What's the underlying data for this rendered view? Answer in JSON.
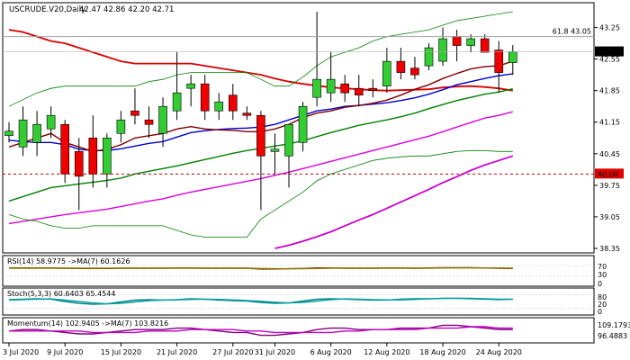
{
  "header": {
    "symbol": "USCRUDE.V20,Daily",
    "ohlc": "42.47 42.86 42.20 42.71"
  },
  "chart_data": [
    {
      "type": "candlestick",
      "title": "USCRUDE.V20,Daily",
      "ylim": [
        38.25,
        43.8
      ],
      "y_ticks": [
        "43.25",
        "42.55",
        "41.85",
        "41.15",
        "40.45",
        "39.75",
        "39.05",
        "38.35"
      ],
      "x_ticks": [
        "3 Jul 2020",
        "9 Jul 2020",
        "15 Jul 2020",
        "21 Jul 2020",
        "27 Jul 2020",
        "31 Jul 2020",
        "6 Aug 2020",
        "12 Aug 2020",
        "18 Aug 2020",
        "24 Aug 2020"
      ],
      "x_tick_index": [
        0,
        4,
        8,
        12,
        16,
        19,
        23,
        27,
        31,
        35
      ],
      "candles": [
        {
          "o": 40.85,
          "h": 41.15,
          "l": 40.7,
          "c": 40.95
        },
        {
          "o": 40.6,
          "h": 41.5,
          "l": 40.4,
          "c": 41.2
        },
        {
          "o": 40.7,
          "h": 41.4,
          "l": 40.4,
          "c": 41.1
        },
        {
          "o": 41.0,
          "h": 41.5,
          "l": 40.8,
          "c": 41.3
        },
        {
          "o": 41.1,
          "h": 41.2,
          "l": 39.8,
          "c": 40.0
        },
        {
          "o": 40.5,
          "h": 40.8,
          "l": 39.2,
          "c": 39.95
        },
        {
          "o": 40.8,
          "h": 41.3,
          "l": 39.7,
          "c": 40.0
        },
        {
          "o": 40.0,
          "h": 40.9,
          "l": 39.7,
          "c": 40.8
        },
        {
          "o": 40.9,
          "h": 41.4,
          "l": 40.7,
          "c": 41.2
        },
        {
          "o": 41.4,
          "h": 41.9,
          "l": 41.1,
          "c": 41.3
        },
        {
          "o": 41.2,
          "h": 41.5,
          "l": 40.8,
          "c": 41.1
        },
        {
          "o": 40.9,
          "h": 41.7,
          "l": 40.6,
          "c": 41.5
        },
        {
          "o": 41.4,
          "h": 42.7,
          "l": 41.2,
          "c": 41.8
        },
        {
          "o": 41.9,
          "h": 42.2,
          "l": 41.5,
          "c": 42.0
        },
        {
          "o": 42.0,
          "h": 42.2,
          "l": 41.2,
          "c": 41.4
        },
        {
          "o": 41.4,
          "h": 41.8,
          "l": 41.2,
          "c": 41.6
        },
        {
          "o": 41.75,
          "h": 42.0,
          "l": 41.2,
          "c": 41.4
        },
        {
          "o": 41.35,
          "h": 41.5,
          "l": 41.2,
          "c": 41.3
        },
        {
          "o": 41.3,
          "h": 41.4,
          "l": 39.2,
          "c": 40.4
        },
        {
          "o": 40.5,
          "h": 40.9,
          "l": 40.0,
          "c": 40.55
        },
        {
          "o": 40.4,
          "h": 41.1,
          "l": 39.7,
          "c": 41.1
        },
        {
          "o": 40.7,
          "h": 41.6,
          "l": 40.5,
          "c": 41.5
        },
        {
          "o": 41.7,
          "h": 43.6,
          "l": 41.5,
          "c": 42.1
        },
        {
          "o": 41.8,
          "h": 42.7,
          "l": 41.6,
          "c": 42.1
        },
        {
          "o": 42.0,
          "h": 42.2,
          "l": 41.6,
          "c": 41.8
        },
        {
          "o": 41.9,
          "h": 42.2,
          "l": 41.5,
          "c": 41.75
        },
        {
          "o": 41.9,
          "h": 42.1,
          "l": 41.7,
          "c": 41.85
        },
        {
          "o": 41.95,
          "h": 42.8,
          "l": 41.8,
          "c": 42.5
        },
        {
          "o": 42.5,
          "h": 42.8,
          "l": 42.1,
          "c": 42.25
        },
        {
          "o": 42.35,
          "h": 42.6,
          "l": 42.1,
          "c": 42.2
        },
        {
          "o": 42.4,
          "h": 42.9,
          "l": 42.3,
          "c": 42.8
        },
        {
          "o": 42.5,
          "h": 43.25,
          "l": 42.4,
          "c": 43.0
        },
        {
          "o": 43.05,
          "h": 43.2,
          "l": 42.5,
          "c": 42.85
        },
        {
          "o": 42.85,
          "h": 43.1,
          "l": 42.7,
          "c": 43.0
        },
        {
          "o": 43.0,
          "h": 43.1,
          "l": 42.7,
          "c": 42.7
        },
        {
          "o": 42.75,
          "h": 42.95,
          "l": 41.8,
          "c": 42.25
        },
        {
          "o": 42.47,
          "h": 42.86,
          "l": 42.2,
          "c": 42.71
        }
      ],
      "overlays": [
        {
          "color": "#d80000",
          "values": [
            43.2,
            43.15,
            43.05,
            42.95,
            42.9,
            42.8,
            42.7,
            42.6,
            42.5,
            42.45,
            42.45,
            42.45,
            42.45,
            42.45,
            42.4,
            42.35,
            42.3,
            42.25,
            42.2,
            42.12,
            42.05,
            42.0,
            41.96,
            41.92,
            41.9,
            41.88,
            41.86,
            41.85,
            41.86,
            41.87,
            41.88,
            41.92,
            41.94,
            41.95,
            41.93,
            41.9,
            41.85
          ]
        },
        {
          "color": "#0000cc",
          "values": [
            40.75,
            40.72,
            40.7,
            40.7,
            40.65,
            40.55,
            40.52,
            40.52,
            40.56,
            40.62,
            40.68,
            40.72,
            40.82,
            40.92,
            40.96,
            40.99,
            41.01,
            41.02,
            41.04,
            41.1,
            41.2,
            41.3,
            41.4,
            41.44,
            41.5,
            41.52,
            41.55,
            41.58,
            41.63,
            41.69,
            41.77,
            41.87,
            41.98,
            42.05,
            42.12,
            42.18,
            42.22
          ]
        },
        {
          "color": "#800000",
          "values": [
            40.6,
            40.7,
            40.8,
            40.9,
            40.7,
            40.6,
            40.5,
            40.55,
            40.65,
            40.8,
            40.85,
            40.9,
            41.0,
            41.05,
            41.0,
            40.98,
            40.97,
            40.94,
            40.94,
            41.0,
            41.1,
            41.25,
            41.35,
            41.4,
            41.48,
            41.52,
            41.57,
            41.64,
            41.75,
            41.88,
            41.98,
            42.12,
            42.23,
            42.33,
            42.38,
            42.4,
            42.5
          ]
        },
        {
          "color": "#008000",
          "values": [
            39.4,
            39.5,
            39.6,
            39.7,
            39.74,
            39.78,
            39.82,
            39.86,
            39.91,
            40.0,
            40.06,
            40.12,
            40.18,
            40.25,
            40.32,
            40.39,
            40.46,
            40.52,
            40.57,
            40.62,
            40.67,
            40.74,
            40.83,
            40.92,
            41.0,
            41.08,
            41.14,
            41.2,
            41.27,
            41.35,
            41.45,
            41.54,
            41.63,
            41.7,
            41.77,
            41.82,
            41.89
          ]
        },
        {
          "color": "#dd00dd",
          "values": [
            38.9,
            38.95,
            39.0,
            39.05,
            39.1,
            39.14,
            39.18,
            39.22,
            39.28,
            39.34,
            39.4,
            39.45,
            39.53,
            39.6,
            39.66,
            39.72,
            39.78,
            39.84,
            39.9,
            39.97,
            40.04,
            40.12,
            40.2,
            40.28,
            40.36,
            40.44,
            40.52,
            40.6,
            40.68,
            40.76,
            40.84,
            40.94,
            41.04,
            41.14,
            41.24,
            41.3,
            41.38
          ]
        },
        {
          "color": "#cc00cc",
          "values": [
            null,
            null,
            null,
            null,
            null,
            null,
            null,
            null,
            null,
            null,
            null,
            null,
            null,
            null,
            null,
            null,
            null,
            null,
            null,
            38.35,
            38.42,
            38.51,
            38.61,
            38.72,
            38.85,
            38.98,
            39.1,
            39.24,
            39.38,
            39.52,
            39.66,
            39.81,
            39.94,
            40.08,
            40.2,
            40.3,
            40.4
          ]
        },
        {
          "color": "#008000",
          "values": [
            41.5,
            41.65,
            41.8,
            41.9,
            41.95,
            41.95,
            41.95,
            41.95,
            41.95,
            41.95,
            42.05,
            42.1,
            42.2,
            42.25,
            42.25,
            42.25,
            42.25,
            42.25,
            42.1,
            41.95,
            41.95,
            42.15,
            42.4,
            42.6,
            42.7,
            42.8,
            42.95,
            43.05,
            43.1,
            43.15,
            43.2,
            43.3,
            43.4,
            43.45,
            43.5,
            43.55,
            43.6
          ]
        },
        {
          "color": "#008000",
          "values": [
            39.1,
            39.0,
            38.95,
            38.85,
            38.8,
            38.8,
            38.85,
            38.85,
            38.85,
            38.85,
            38.85,
            38.85,
            38.75,
            38.65,
            38.6,
            38.6,
            38.6,
            38.6,
            39.0,
            39.2,
            39.4,
            39.6,
            39.85,
            40.0,
            40.1,
            40.2,
            40.3,
            40.35,
            40.38,
            40.4,
            40.4,
            40.45,
            40.5,
            40.52,
            40.52,
            40.5,
            40.5
          ]
        }
      ],
      "levels": [
        {
          "value": 43.05,
          "label": "61.8 43.05",
          "color": "#a0a0a0",
          "style": "solid"
        },
        {
          "value": 40.0,
          "label": "40.00",
          "color": "#c00000",
          "style": "dashed"
        }
      ],
      "current_price": {
        "value": 42.71,
        "label": "42.71"
      }
    },
    {
      "type": "line",
      "title": "RSI(14) 58.9775 ->MA(7) 60.1626",
      "y_ticks": [
        "70",
        "30",
        "0"
      ],
      "series": [
        {
          "color": "#a00000",
          "values": [
            61,
            61,
            61,
            61,
            60,
            59,
            59,
            59,
            60,
            60,
            60,
            60,
            61,
            61,
            60,
            60,
            60,
            60,
            57,
            57,
            58,
            59,
            61,
            61,
            60,
            60,
            60,
            61,
            61,
            60,
            61,
            62,
            62,
            62,
            61,
            60,
            59
          ]
        },
        {
          "color": "#808000",
          "values": [
            60,
            60,
            60,
            60,
            60,
            60,
            60,
            60,
            60,
            60,
            60,
            60,
            60,
            60,
            60,
            60,
            60,
            60,
            59,
            58,
            58,
            58,
            59,
            60,
            60,
            60,
            60,
            60,
            60,
            60,
            60,
            61,
            61,
            61,
            61,
            61,
            60
          ]
        }
      ]
    },
    {
      "type": "line",
      "title": "Stoch(5,3,3) 60.6403 65.4544",
      "y_ticks": [
        "80",
        "20",
        "0"
      ],
      "series": [
        {
          "color": "#008080",
          "values": [
            58,
            60,
            62,
            60,
            50,
            42,
            38,
            40,
            48,
            56,
            58,
            56,
            58,
            62,
            60,
            56,
            54,
            52,
            46,
            42,
            44,
            52,
            60,
            62,
            60,
            58,
            56,
            56,
            60,
            62,
            62,
            64,
            64,
            62,
            60,
            58,
            60
          ]
        },
        {
          "color": "#00a0a0",
          "values": [
            56,
            58,
            60,
            61,
            56,
            50,
            44,
            40,
            42,
            48,
            54,
            56,
            57,
            59,
            60,
            59,
            57,
            54,
            51,
            47,
            44,
            46,
            52,
            58,
            61,
            60,
            58,
            57,
            57,
            59,
            61,
            63,
            64,
            64,
            62,
            60,
            60
          ]
        }
      ]
    },
    {
      "type": "line",
      "title": "Momentum(14) 102.9405 ->MA(7) 103.8216",
      "y_ticks": [
        "109.1793",
        "96.4883"
      ],
      "series": [
        {
          "color": "#800080",
          "values": [
            102,
            103,
            103,
            102,
            101,
            100,
            100,
            101,
            102,
            103,
            103,
            103,
            104,
            104,
            103,
            102,
            101,
            101,
            99,
            99,
            100,
            101,
            103,
            104,
            104,
            103,
            103,
            103,
            104,
            104,
            104,
            106,
            106,
            105,
            104,
            103,
            103
          ]
        },
        {
          "color": "#c000c0",
          "values": [
            102,
            102,
            102,
            102,
            102,
            102,
            101,
            101,
            101,
            101,
            102,
            102,
            102,
            103,
            103,
            103,
            103,
            102,
            102,
            101,
            101,
            101,
            101,
            101,
            102,
            102,
            103,
            103,
            103,
            103,
            104,
            104,
            104,
            105,
            105,
            104,
            104
          ]
        }
      ]
    }
  ]
}
